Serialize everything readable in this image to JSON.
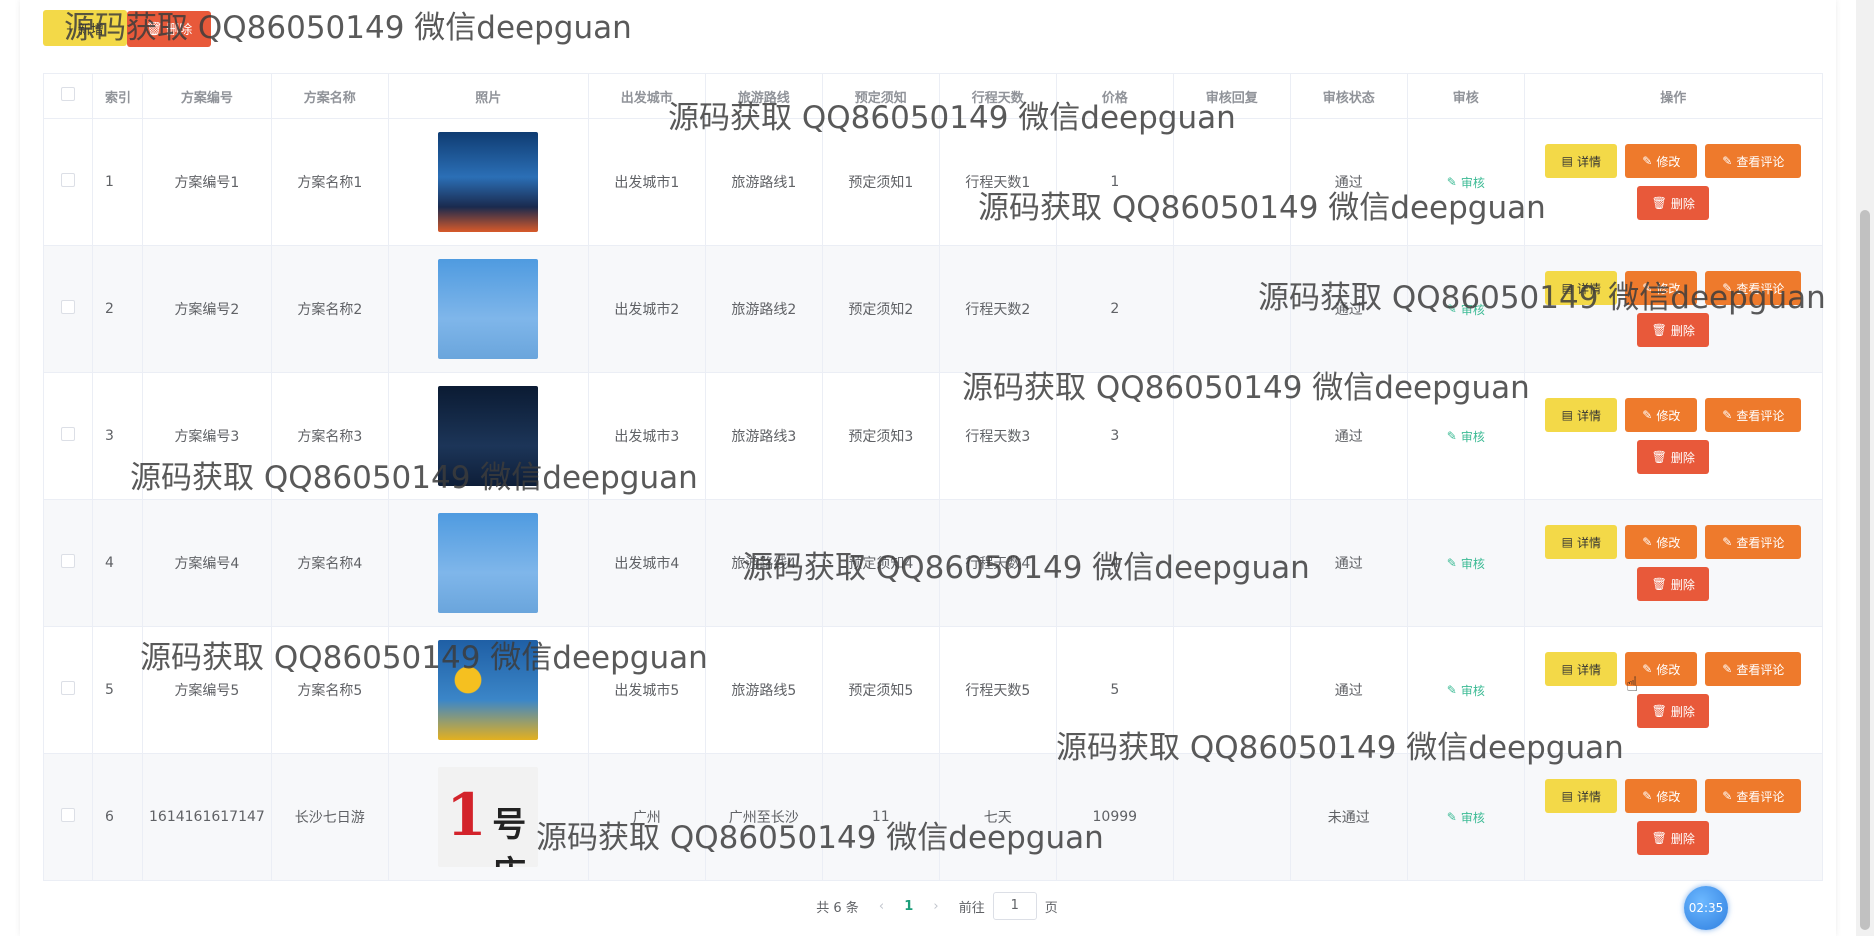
{
  "toolbar": {
    "add_label": "新增",
    "delete_label": "删除"
  },
  "table": {
    "headers": [
      "索引",
      "方案编号",
      "方案名称",
      "照片",
      "出发城市",
      "旅游路线",
      "预定须知",
      "行程天数",
      "价格",
      "审核回复",
      "审核状态",
      "审核",
      "操作"
    ],
    "rows": [
      {
        "index": "1",
        "code": "方案编号1",
        "name": "方案名称1",
        "city": "出发城市1",
        "route": "旅游路线1",
        "notice": "预定须知1",
        "days": "行程天数1",
        "price": "1",
        "reply": "",
        "status": "通过"
      },
      {
        "index": "2",
        "code": "方案编号2",
        "name": "方案名称2",
        "city": "出发城市2",
        "route": "旅游路线2",
        "notice": "预定须知2",
        "days": "行程天数2",
        "price": "2",
        "reply": "",
        "status": "通过"
      },
      {
        "index": "3",
        "code": "方案编号3",
        "name": "方案名称3",
        "city": "出发城市3",
        "route": "旅游路线3",
        "notice": "预定须知3",
        "days": "行程天数3",
        "price": "3",
        "reply": "",
        "status": "通过"
      },
      {
        "index": "4",
        "code": "方案编号4",
        "name": "方案名称4",
        "city": "出发城市4",
        "route": "旅游路线4",
        "notice": "预定须知4",
        "days": "行程天数4",
        "price": "4",
        "reply": "",
        "status": "通过"
      },
      {
        "index": "5",
        "code": "方案编号5",
        "name": "方案名称5",
        "city": "出发城市5",
        "route": "旅游路线5",
        "notice": "预定须知5",
        "days": "行程天数5",
        "price": "5",
        "reply": "",
        "status": "通过"
      },
      {
        "index": "6",
        "code": "1614161617147",
        "name": "长沙七日游",
        "city": "广州",
        "route": "广州至长沙",
        "notice": "11",
        "days": "七天",
        "price": "10999",
        "reply": "",
        "status": "未通过"
      }
    ],
    "review_label": "审核",
    "ops": {
      "detail": "详情",
      "edit": "修改",
      "comment": "查看评论",
      "delete": "删除"
    },
    "photo_text_6a": "1",
    "photo_text_6b": "号店"
  },
  "pagination": {
    "total": "共 6 条",
    "current": "1",
    "goto_prefix": "前往",
    "goto_value": "1",
    "goto_suffix": "页"
  },
  "timer": "02:35",
  "watermark": "源码获取 QQ86050149 微信deepguan",
  "colors": {
    "detail_btn": "#f3d948",
    "edit_btn": "#ee7a2c",
    "delete_btn": "#e8593a",
    "review_link": "#3dbb95"
  }
}
